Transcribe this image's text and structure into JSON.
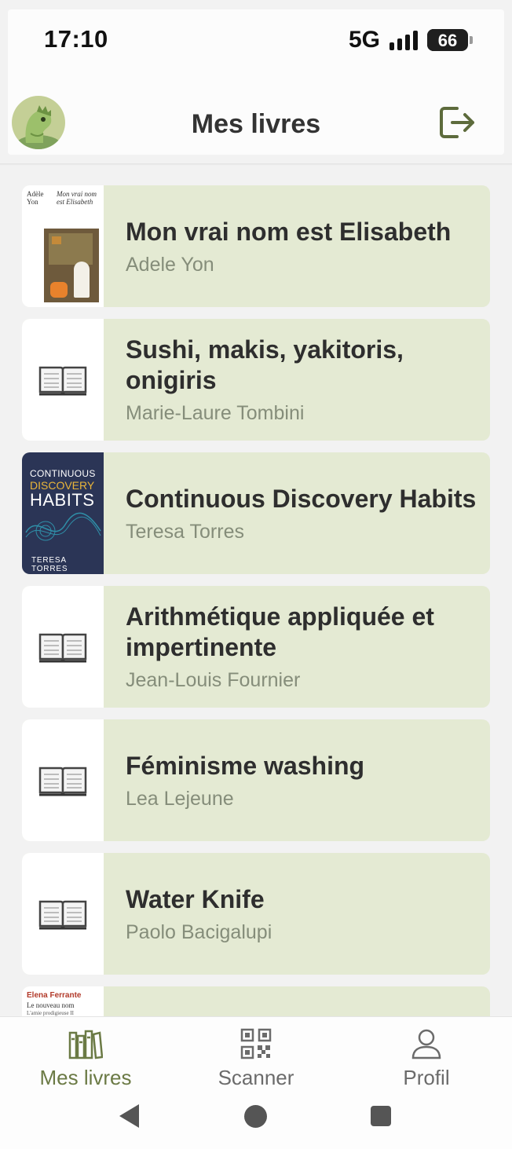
{
  "status_bar": {
    "time": "17:10",
    "network": "5G",
    "battery": "66",
    "battery_fraction": 0.66
  },
  "header": {
    "title": "Mes livres"
  },
  "books": [
    {
      "title": "Mon vrai nom est Elisabeth",
      "author": "Adele Yon",
      "cover": "cover-image",
      "cover_texts": [
        "Adèle",
        "Yon",
        "Mon vrai nom",
        "est Elisabeth"
      ]
    },
    {
      "title": "Sushi, makis, yakitoris, onigiris",
      "author": "Marie-Laure Tombini",
      "cover": "book-icon"
    },
    {
      "title": "Continuous Discovery Habits",
      "author": "Teresa Torres",
      "cover": "cover-image",
      "cover_texts": [
        "CONTINUOUS",
        "DISCOVERY",
        "HABITS",
        "TERESA TORRES"
      ]
    },
    {
      "title": "Arithmétique appliquée et impertinente",
      "author": "Jean-Louis Fournier",
      "cover": "book-icon"
    },
    {
      "title": "Féminisme washing",
      "author": "Lea Lejeune",
      "cover": "book-icon"
    },
    {
      "title": "Water Knife",
      "author": "Paolo Bacigalupi",
      "cover": "book-icon"
    },
    {
      "title": "",
      "author": "",
      "cover": "cover-image",
      "cover_texts": [
        "Elena Ferrante",
        "Le nouveau nom",
        "L'amie prodigieuse II"
      ]
    }
  ],
  "nav": {
    "items": [
      {
        "label": "Mes livres",
        "icon": "bookshelf-icon",
        "active": true
      },
      {
        "label": "Scanner",
        "icon": "qr-code-icon",
        "active": false
      },
      {
        "label": "Profil",
        "icon": "person-icon",
        "active": false
      }
    ]
  },
  "colors": {
    "card": "#e4ead3",
    "accent": "#6b7a45",
    "muted": "#858d7a",
    "inactive": "#6b6b6b"
  }
}
